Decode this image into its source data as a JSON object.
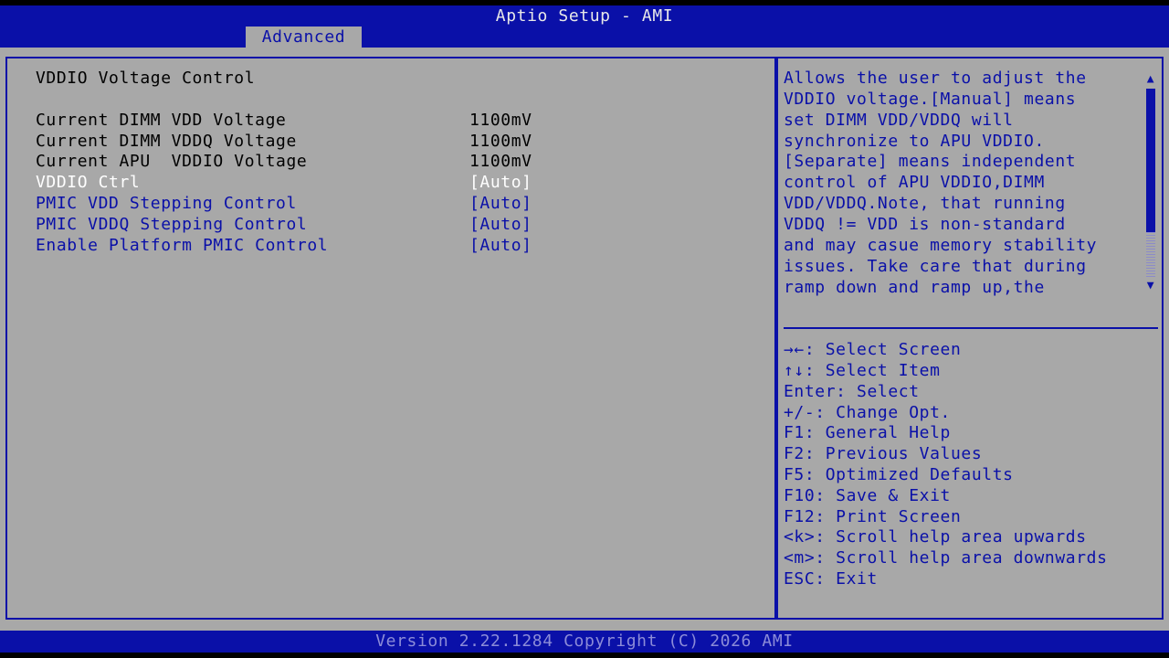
{
  "app": {
    "title": "Aptio Setup - AMI",
    "active_tab": "Advanced",
    "footer": "Version 2.22.1284 Copyright (C) 2026 AMI"
  },
  "left_panel": {
    "heading": "VDDIO Voltage Control",
    "info_rows": [
      {
        "label": "Current DIMM VDD Voltage",
        "value": "1100mV"
      },
      {
        "label": "Current DIMM VDDQ Voltage",
        "value": "1100mV"
      },
      {
        "label": "Current APU  VDDIO Voltage",
        "value": "1100mV"
      }
    ],
    "option_rows": [
      {
        "label": "VDDIO Ctrl",
        "value": "[Auto]",
        "selected": true
      },
      {
        "label": "PMIC VDD Stepping Control",
        "value": "[Auto]",
        "selected": false
      },
      {
        "label": "PMIC VDDQ Stepping Control",
        "value": "[Auto]",
        "selected": false
      },
      {
        "label": "Enable Platform PMIC Control",
        "value": "[Auto]",
        "selected": false
      }
    ]
  },
  "help_panel": {
    "description_lines": [
      "Allows the user to adjust the",
      "VDDIO voltage.[Manual] means",
      "set DIMM VDD/VDDQ will",
      "synchronize to APU VDDIO.",
      "[Separate] means independent",
      "control of APU VDDIO,DIMM",
      "VDD/VDDQ.Note, that running",
      "VDDQ != VDD is non-standard",
      "and may casue memory stability",
      "issues. Take care that during",
      "ramp down and ramp up,the"
    ],
    "keys": [
      "→←: Select Screen",
      "↑↓: Select Item",
      "Enter: Select",
      "+/-: Change Opt.",
      "F1: General Help",
      "F2: Previous Values",
      "F5: Optimized Defaults",
      "F10: Save & Exit",
      "F12: Print Screen",
      "<k>: Scroll help area upwards",
      "<m>: Scroll help area downwards",
      "ESC: Exit"
    ],
    "scroll_up_icon": "triangle-up",
    "scroll_down_icon": "triangle-down"
  },
  "colors": {
    "frame_blue": "#0a10a8",
    "panel_gray": "#a8a8a8",
    "selected_text": "#ffffff"
  }
}
